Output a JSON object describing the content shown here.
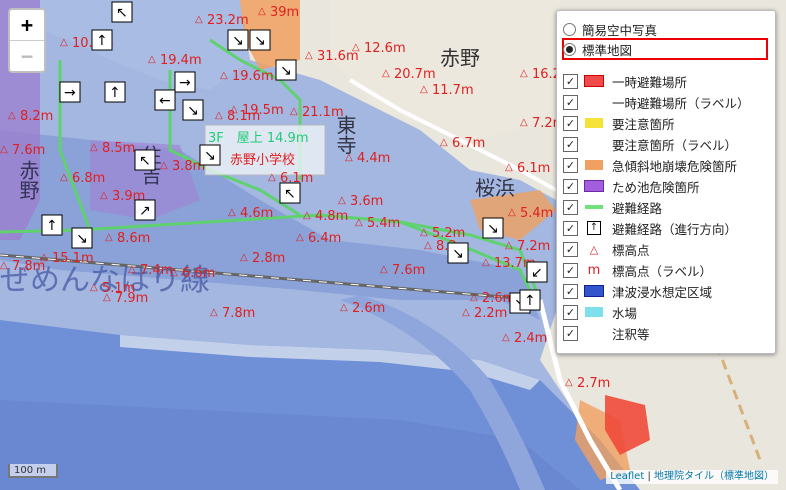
{
  "zoom": {
    "in_label": "+",
    "out_label": "−"
  },
  "map_labels": {
    "place_akano": "赤野",
    "place_higashitera": "東寺",
    "place_sakurahama": "桜浜",
    "place_akano_west": "赤野",
    "place_sumiyoshi": "住吉",
    "school": "赤野小学校",
    "school_floor": "3F　屋上 14.9m",
    "sea_text": "ぜめんなはり線"
  },
  "elevations": [
    "10.5m",
    "23.2m",
    "39m",
    "12.6m",
    "20.7m",
    "16.2m",
    "11.7m",
    "19.4m",
    "19.6m",
    "31.6m",
    "19.5m",
    "21.1m",
    "8.2m",
    "8.5m",
    "3.8m",
    "8.1m",
    "7.6m",
    "6.8m",
    "3.9m",
    "6.1m",
    "4.4m",
    "6.7m",
    "6.1m",
    "7.2m",
    "3.6m",
    "4.6m",
    "4.8m",
    "5.4m",
    "6.4m",
    "5.4m",
    "5.2m",
    "8.2m",
    "7.2m",
    "13.7m",
    "8.6m",
    "15.1m",
    "7.8m",
    "7.4m",
    "6.6m",
    "2.8m",
    "7.6m",
    "7.9m",
    "7.8m",
    "5.1m",
    "2.6m",
    "2.6m",
    "2.2m",
    "2.4m",
    "2.7m"
  ],
  "layer_panel": {
    "base_layers": [
      {
        "label": "簡易空中写真",
        "selected": false
      },
      {
        "label": "標準地図",
        "selected": true
      }
    ],
    "overlays": [
      {
        "label": "一時避難場所",
        "checked": true,
        "icon": "red-rect"
      },
      {
        "label": "一時避難場所（ラベル）",
        "checked": true,
        "icon": "none"
      },
      {
        "label": "要注意箇所",
        "checked": true,
        "icon": "yellow-rect"
      },
      {
        "label": "要注意箇所（ラベル）",
        "checked": true,
        "icon": "none"
      },
      {
        "label": "急傾斜地崩壊危険箇所",
        "checked": true,
        "icon": "orange-rect"
      },
      {
        "label": "ため池危険箇所",
        "checked": true,
        "icon": "purple-rect"
      },
      {
        "label": "避難経路",
        "checked": true,
        "icon": "green-line"
      },
      {
        "label": "避難経路（進行方向）",
        "checked": true,
        "icon": "arrow-box"
      },
      {
        "label": "標高点",
        "checked": true,
        "icon": "red-triangle"
      },
      {
        "label": "標高点（ラベル）",
        "checked": true,
        "icon": "red-m"
      },
      {
        "label": "津波浸水想定区域",
        "checked": true,
        "icon": "blue-rect"
      },
      {
        "label": "水場",
        "checked": true,
        "icon": "cyan-rect"
      },
      {
        "label": "注釈等",
        "checked": true,
        "icon": "none"
      }
    ]
  },
  "scale": {
    "label": "100 m"
  },
  "attribution": {
    "leaflet": "Leaflet",
    "separator": " | ",
    "tiles": "地理院タイル（標準地図）"
  },
  "colors": {
    "flood": "#8fa8dc",
    "sea": "#6a8fd6",
    "green_route": "#5fd16f",
    "red_text": "#e02020",
    "hazard_orange": "#f0a060"
  }
}
